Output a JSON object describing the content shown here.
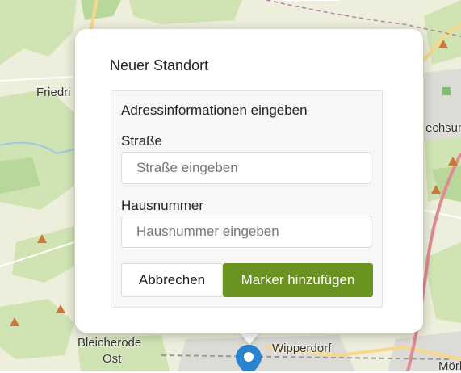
{
  "map": {
    "labels": [
      "Friedri",
      "echsun",
      "Bleicherode",
      "Ost",
      "Wipperdorf",
      "Mörba"
    ]
  },
  "popup": {
    "title": "Neuer Standort",
    "section_title": "Adressinformationen eingeben",
    "street": {
      "label": "Straße",
      "placeholder": "Straße eingeben",
      "value": ""
    },
    "house_number": {
      "label": "Hausnummer",
      "placeholder": "Hausnummer eingeben",
      "value": ""
    },
    "cancel_label": "Abbrechen",
    "add_label": "Marker hinzufügen"
  },
  "colors": {
    "accent": "#6b9322",
    "marker": "#2a83cf",
    "railway": "#e08a93",
    "forest": "#b9d79a",
    "map_background": "#edeedb"
  },
  "icons": {
    "marker": "map-marker-icon",
    "peak": "peak-triangle-icon"
  }
}
